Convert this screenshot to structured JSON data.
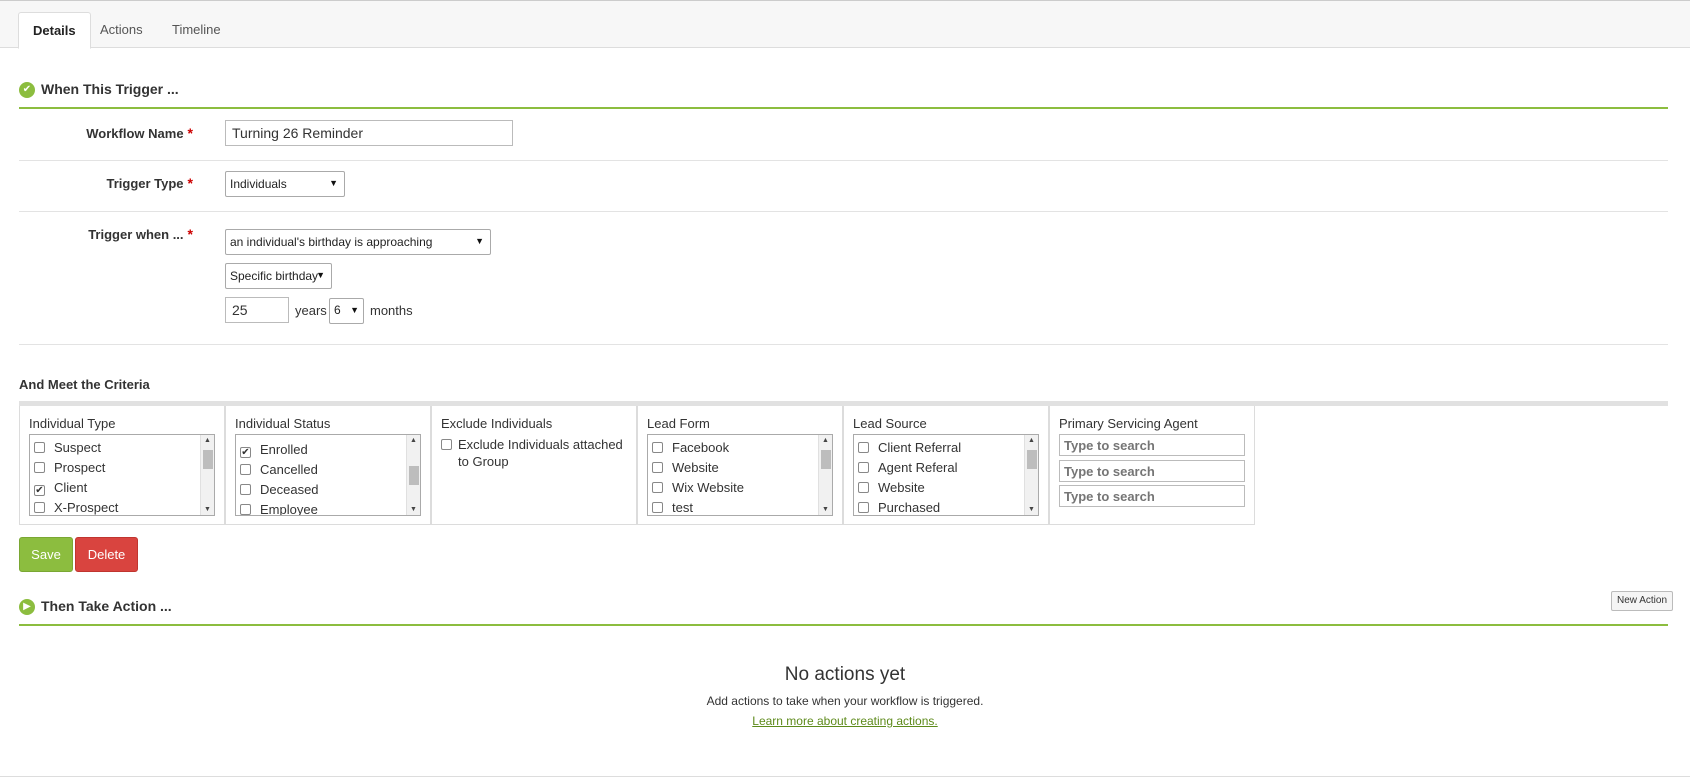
{
  "tabs": [
    {
      "label": "Details"
    },
    {
      "label": "Actions"
    },
    {
      "label": "Timeline"
    }
  ],
  "trigger_section": {
    "title": "When This Trigger ..."
  },
  "form": {
    "workflow_name": {
      "label": "Workflow Name",
      "required": "*",
      "value": "Turning 26 Reminder"
    },
    "trigger_type": {
      "label": "Trigger Type",
      "required": "*",
      "value": "Individuals"
    },
    "trigger_when": {
      "label": "Trigger when ...",
      "required": "*",
      "event": "an individual's birthday is approaching",
      "birthday_mode": "Specific birthday",
      "years_value": "25",
      "years_label": "years",
      "months_value": "6",
      "months_label": "months"
    }
  },
  "criteria": {
    "title": "And Meet the Criteria",
    "individual_type": {
      "label": "Individual Type",
      "options": [
        {
          "label": "Suspect",
          "checked": false
        },
        {
          "label": "Prospect",
          "checked": false
        },
        {
          "label": "Client",
          "checked": true
        },
        {
          "label": "X-Prospect",
          "checked": false
        }
      ]
    },
    "individual_status": {
      "label": "Individual Status",
      "options": [
        {
          "label": "Enrolled",
          "checked": true
        },
        {
          "label": "Cancelled",
          "checked": false
        },
        {
          "label": "Deceased",
          "checked": false
        },
        {
          "label": "Employee",
          "checked": false
        }
      ]
    },
    "exclude_individuals": {
      "label": "Exclude Individuals",
      "option_line1": "Exclude Individuals attached",
      "option_line2": "to Group",
      "checked": false
    },
    "lead_form": {
      "label": "Lead Form",
      "options": [
        {
          "label": "Facebook",
          "checked": false
        },
        {
          "label": "Website",
          "checked": false
        },
        {
          "label": "Wix Website",
          "checked": false
        },
        {
          "label": "test",
          "checked": false
        }
      ]
    },
    "lead_source": {
      "label": "Lead Source",
      "options": [
        {
          "label": "Client Referral",
          "checked": false
        },
        {
          "label": "Agent Referal",
          "checked": false
        },
        {
          "label": "Website",
          "checked": false
        },
        {
          "label": "Purchased",
          "checked": false
        }
      ]
    },
    "primary_servicing_agent": {
      "label": "Primary Servicing Agent",
      "search_placeholders": [
        "Type to search",
        "Type to search",
        "Type to search"
      ]
    }
  },
  "buttons": {
    "save": "Save",
    "delete": "Delete",
    "new_action": "New Action"
  },
  "action_section": {
    "title": "Then Take Action ...",
    "empty_title": "No actions yet",
    "empty_subtitle": "Add actions to take when your workflow is triggered.",
    "learn_more": "Learn more about creating actions."
  },
  "colors": {
    "accent": "#8cbd3f",
    "danger": "#d9443f",
    "required": "#cc0000",
    "link": "#5d8a1a"
  },
  "icons": {
    "trigger": "check-circle-icon",
    "action": "play-circle-icon"
  }
}
